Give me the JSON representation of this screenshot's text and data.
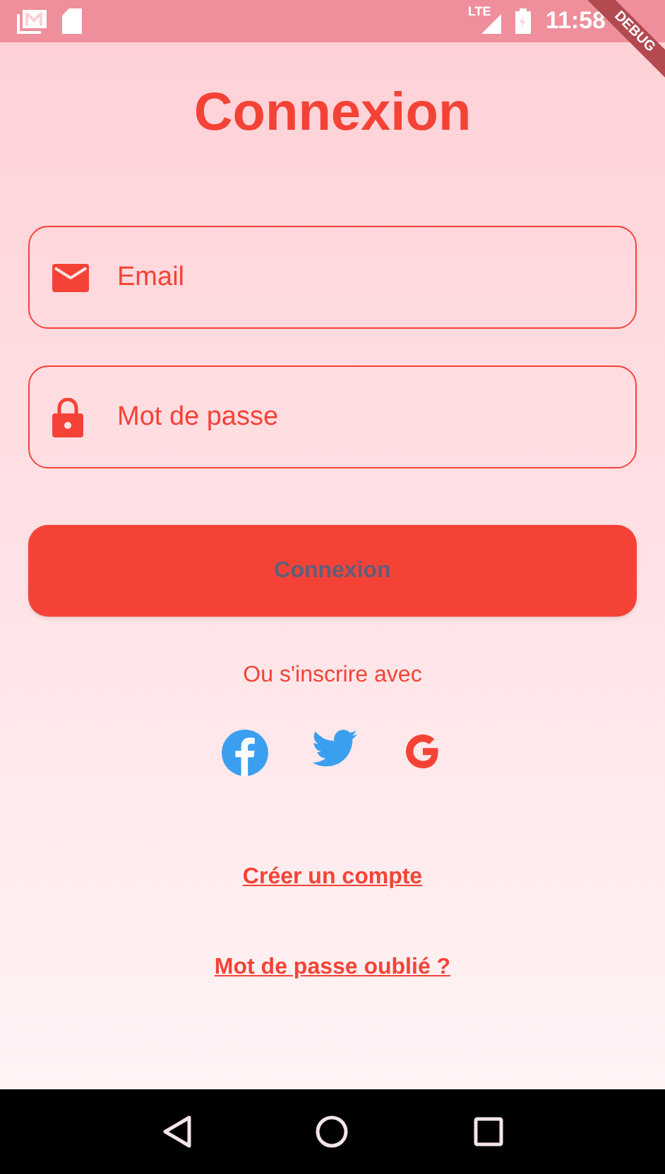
{
  "status_bar": {
    "time": "11:58",
    "network": "LTE"
  },
  "debug_banner": "DEBUG",
  "title": "Connexion",
  "fields": [
    {
      "kind": "email",
      "placeholder": "Email"
    },
    {
      "kind": "password",
      "placeholder": "Mot de passe"
    }
  ],
  "login_button": "Connexion",
  "social_prompt": "Ou s'inscrire avec",
  "social": [
    {
      "kind": "facebook"
    },
    {
      "kind": "twitter"
    },
    {
      "kind": "google"
    }
  ],
  "links": [
    "Créer un compte",
    "Mot de passe oublié ?"
  ]
}
